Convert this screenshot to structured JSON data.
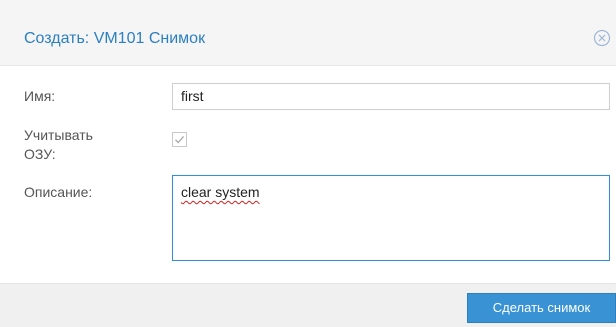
{
  "dialog": {
    "title": "Создать: VM101 Снимок",
    "close_icon": "close-circle-icon"
  },
  "form": {
    "name": {
      "label": "Имя:",
      "value": "first"
    },
    "include_ram": {
      "label_line1": "Учитывать",
      "label_line2": "ОЗУ:",
      "checked": true
    },
    "description": {
      "label": "Описание:",
      "value": "clear system"
    }
  },
  "footer": {
    "primary_button": "Сделать снимок"
  },
  "colors": {
    "accent": "#3892d4",
    "title": "#2c7fc0",
    "focus_border": "#2f8fd8"
  }
}
